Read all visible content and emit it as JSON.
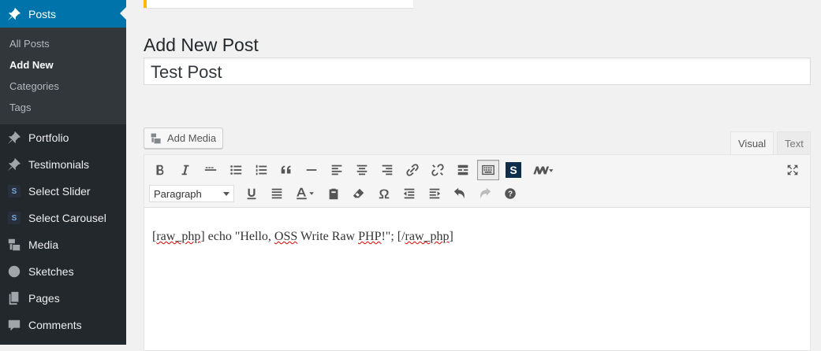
{
  "sidebar": {
    "posts_label": "Posts",
    "submenu": [
      "All Posts",
      "Add New",
      "Categories",
      "Tags"
    ],
    "items": [
      {
        "label": "Portfolio",
        "icon": "pin-icon"
      },
      {
        "label": "Testimonials",
        "icon": "pin-icon"
      },
      {
        "label": "Select Slider",
        "icon": "s-icon"
      },
      {
        "label": "Select Carousel",
        "icon": "s-icon"
      },
      {
        "label": "Media",
        "icon": "media-icon"
      },
      {
        "label": "Sketches",
        "icon": "sketches-icon"
      },
      {
        "label": "Pages",
        "icon": "pages-icon"
      },
      {
        "label": "Comments",
        "icon": "comments-icon"
      }
    ],
    "s_letter": "S"
  },
  "main": {
    "page_title": "Add New Post",
    "title_value": "Test Post",
    "add_media_label": "Add Media",
    "tabs": {
      "visual": "Visual",
      "text": "Text"
    },
    "format_value": "Paragraph",
    "s_button": "S",
    "content": {
      "part1": "[",
      "raw1": "raw_php",
      "part2": "] echo \"Hello, ",
      "oss": "OSS",
      "part3": " Write Raw ",
      "php": "PHP",
      "part4": "!\"; [/",
      "raw2": "raw_php",
      "part5": "]"
    }
  },
  "colors": {
    "accent": "#0073aa",
    "sidebar": "#23282d",
    "notice": "#ffb900"
  }
}
